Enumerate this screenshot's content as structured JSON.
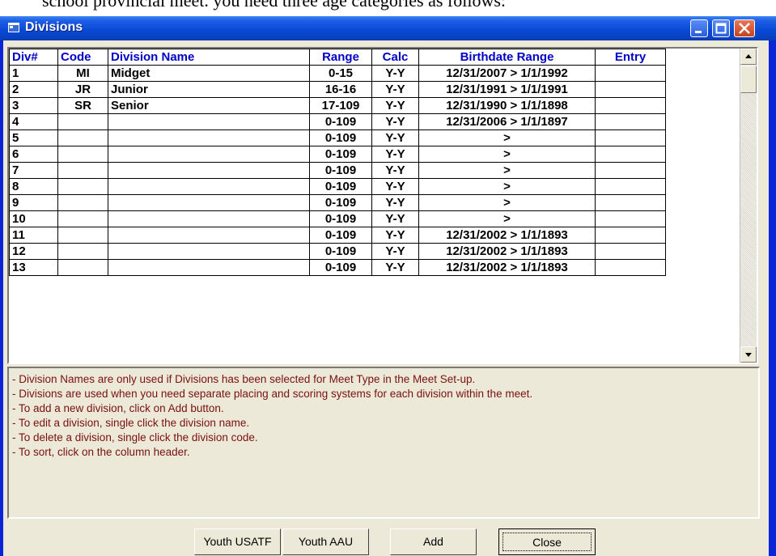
{
  "background_text": "school provincial meet. you need three age categories as follows:",
  "window": {
    "title": "Divisions",
    "icon": "window-app-icon"
  },
  "grid": {
    "headers": [
      "Div#",
      "Code",
      "Division Name",
      "Range",
      "Calc",
      "Birthdate Range",
      "Entry"
    ],
    "rows": [
      [
        "1",
        "MI",
        "Midget",
        "0-15",
        "Y-Y",
        "12/31/2007 > 1/1/1992",
        ""
      ],
      [
        "2",
        "JR",
        "Junior",
        "16-16",
        "Y-Y",
        "12/31/1991 > 1/1/1991",
        ""
      ],
      [
        "3",
        "SR",
        "Senior",
        "17-109",
        "Y-Y",
        "12/31/1990 > 1/1/1898",
        ""
      ],
      [
        "4",
        "",
        "",
        "0-109",
        "Y-Y",
        "12/31/2006 > 1/1/1897",
        ""
      ],
      [
        "5",
        "",
        "",
        "0-109",
        "Y-Y",
        ">",
        ""
      ],
      [
        "6",
        "",
        "",
        "0-109",
        "Y-Y",
        ">",
        ""
      ],
      [
        "7",
        "",
        "",
        "0-109",
        "Y-Y",
        ">",
        ""
      ],
      [
        "8",
        "",
        "",
        "0-109",
        "Y-Y",
        ">",
        ""
      ],
      [
        "9",
        "",
        "",
        "0-109",
        "Y-Y",
        ">",
        ""
      ],
      [
        "10",
        "",
        "",
        "0-109",
        "Y-Y",
        ">",
        ""
      ],
      [
        "11",
        "",
        "",
        "0-109",
        "Y-Y",
        "12/31/2002 > 1/1/1893",
        ""
      ],
      [
        "12",
        "",
        "",
        "0-109",
        "Y-Y",
        "12/31/2002 > 1/1/1893",
        ""
      ],
      [
        "13",
        "",
        "",
        "0-109",
        "Y-Y",
        "12/31/2002 > 1/1/1893",
        ""
      ]
    ]
  },
  "help_lines": [
    "- Division Names are only used if Divisions has been selected for Meet Type in the Meet Set-up.",
    "- Divisions are used when you need separate placing and scoring systems for each division within the meet.",
    "- To add a new division, click on Add button.",
    "- To edit a division, single click the division name.",
    "- To delete a division, single click the division code.",
    "- To sort, click on the column header."
  ],
  "buttons": {
    "youth_usatf": "Youth USATF",
    "youth_aau": "Youth AAU",
    "add": "Add",
    "close": "Close"
  },
  "colors": {
    "title_bar": "#0a4ad6",
    "header_text": "#0000c8",
    "help_text": "#7a1010"
  }
}
